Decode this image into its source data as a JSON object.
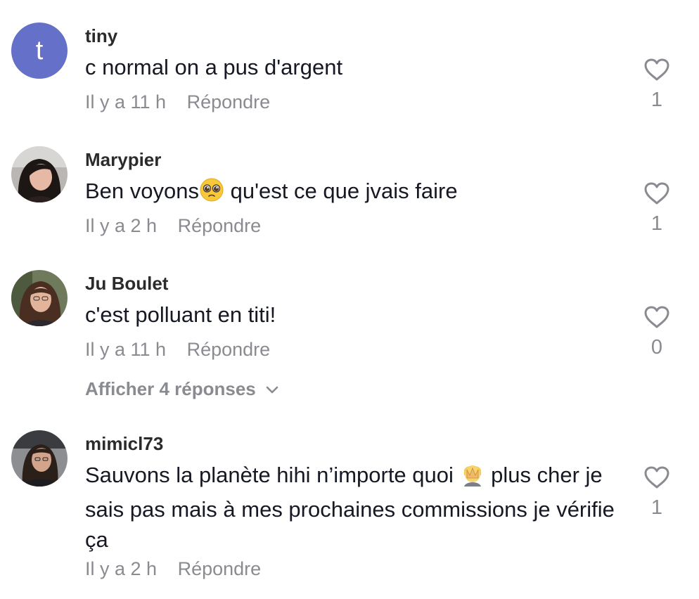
{
  "comments": [
    {
      "avatar_letter": "t",
      "username": "tiny",
      "text": "c normal on a pus d'argent",
      "time": "Il y a 11 h",
      "reply_label": "Répondre",
      "likes": "1"
    },
    {
      "username": "Marypier",
      "text_before": "Ben voyons",
      "text_after": " qu'est ce que jvais faire",
      "time": "Il y a 2 h",
      "reply_label": "Répondre",
      "likes": "1"
    },
    {
      "username": "Ju Boulet",
      "text": "c'est polluant en titi!",
      "time": "Il y a 11 h",
      "reply_label": "Répondre",
      "likes": "0",
      "show_replies_label": "Afficher 4 réponses"
    },
    {
      "username": "mimicl73",
      "text_before": "Sauvons la planète hihi n’importe quoi ",
      "text_after": " plus cher je sais pas mais à mes prochaines commissions je vérifie ça",
      "time": "Il y a 2 h",
      "reply_label": "Répondre",
      "likes": "1"
    }
  ],
  "icons": {
    "like": "heart-outline-icon",
    "expand": "chevron-down-icon",
    "emoji_pleading": "pleading-face-icon",
    "emoji_facepalm": "facepalm-icon"
  },
  "colors": {
    "avatar_letter_bg": "#6570c8",
    "muted_text": "#8a8b91",
    "primary_text": "#161823"
  }
}
